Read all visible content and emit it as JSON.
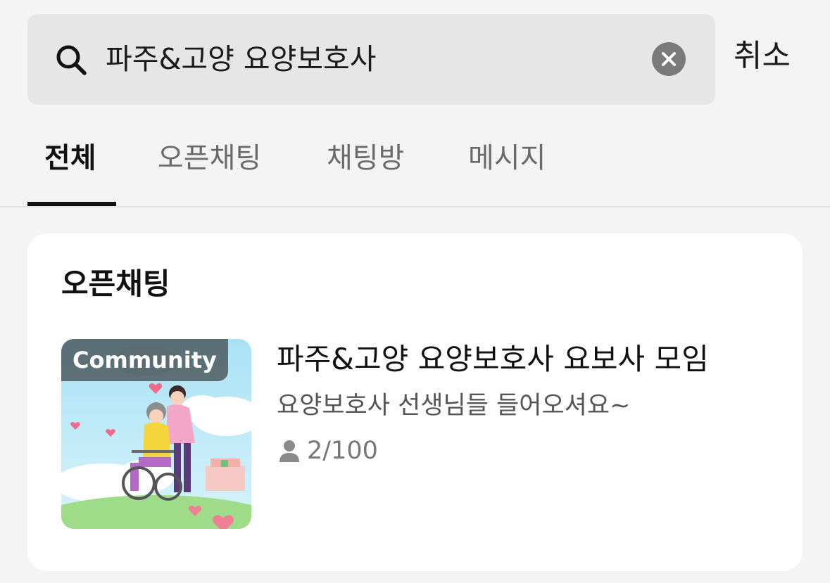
{
  "search": {
    "query": "파주&고양 요양보호사",
    "search_icon": "search-icon",
    "clear_icon": "clear-icon",
    "cancel_label": "취소"
  },
  "tabs": [
    {
      "label": "전체",
      "active": true
    },
    {
      "label": "오픈채팅",
      "active": false
    },
    {
      "label": "채팅방",
      "active": false
    },
    {
      "label": "메시지",
      "active": false
    }
  ],
  "section": {
    "title": "오픈채팅"
  },
  "result": {
    "badge": "Community",
    "title": "파주&고양 요양보호사 요보사 모임",
    "description": "요양보호사 선생님들 들어오셔요~",
    "member_icon": "person-icon",
    "member_count": "2/100"
  },
  "colors": {
    "background": "#f4f4f4",
    "search_bg": "#e6e6e6",
    "card_bg": "#ffffff",
    "active_tab": "#111111",
    "inactive_tab": "#6a6a6a"
  }
}
